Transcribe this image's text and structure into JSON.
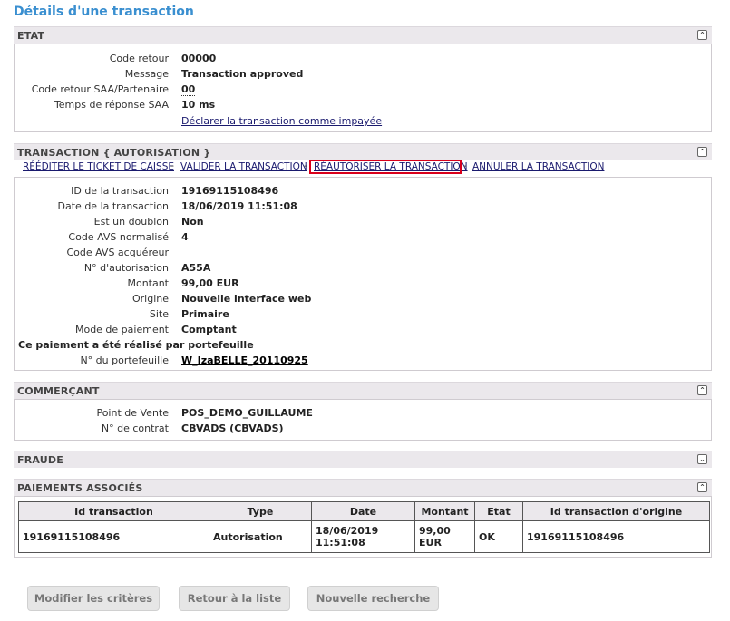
{
  "page_title": "Détails d'une transaction",
  "sections": {
    "etat": {
      "title": "ETAT",
      "rows": [
        {
          "label": "Code retour",
          "value": "00000"
        },
        {
          "label": "Message",
          "value": "Transaction approved"
        },
        {
          "label": "Code retour SAA/Partenaire",
          "value": "00"
        },
        {
          "label": "Temps de réponse SAA",
          "value": "10 ms"
        }
      ],
      "link": "Déclarer la transaction comme impayée"
    },
    "transaction": {
      "title": "TRANSACTION { AUTORISATION }",
      "actions": [
        "RÉÉDITER LE TICKET DE CAISSE",
        "VALIDER LA TRANSACTION",
        "RÉAUTORISER LA TRANSACTION",
        "ANNULER LA TRANSACTION"
      ],
      "separator": "-",
      "rows": [
        {
          "label": "ID de la transaction",
          "value": "19169115108496"
        },
        {
          "label": "Date de la transaction",
          "value": "18/06/2019 11:51:08"
        },
        {
          "label": "Est un doublon",
          "value": "Non"
        },
        {
          "label": "Code AVS normalisé",
          "value": "4"
        },
        {
          "label": "Code AVS acquéreur",
          "value": ""
        },
        {
          "label": "N° d'autorisation",
          "value": "A55A"
        },
        {
          "label": "Montant",
          "value": "99,00 EUR"
        },
        {
          "label": "Origine",
          "value": "Nouvelle interface web"
        },
        {
          "label": "Site",
          "value": "Primaire"
        },
        {
          "label": "Mode de paiement",
          "value": "Comptant"
        }
      ],
      "wallet_note": "Ce paiement a été réalisé par portefeuille",
      "wallet_label": "N° du portefeuille",
      "wallet_value": "W_IzaBELLE_20110925"
    },
    "commercant": {
      "title": "COMMERÇANT",
      "rows": [
        {
          "label": "Point de Vente",
          "value": "POS_DEMO_GUILLAUME"
        },
        {
          "label": "N° de contrat",
          "value": "CBVADS (CBVADS)"
        }
      ]
    },
    "fraude": {
      "title": "FRAUDE"
    },
    "paiements": {
      "title": "PAIEMENTS ASSOCIÉS",
      "columns": [
        "Id transaction",
        "Type",
        "Date",
        "Montant",
        "Etat",
        "Id transaction d'origine"
      ],
      "rows": [
        [
          "19169115108496",
          "Autorisation",
          "18/06/2019 11:51:08",
          "99,00 EUR",
          "OK",
          "19169115108496"
        ]
      ]
    }
  },
  "buttons": {
    "modify": "Modifier les critères",
    "back": "Retour à la liste",
    "new_search": "Nouvelle recherche"
  },
  "icons": {
    "collapse": "double-chevron-up-icon",
    "expand": "double-chevron-down-icon"
  }
}
